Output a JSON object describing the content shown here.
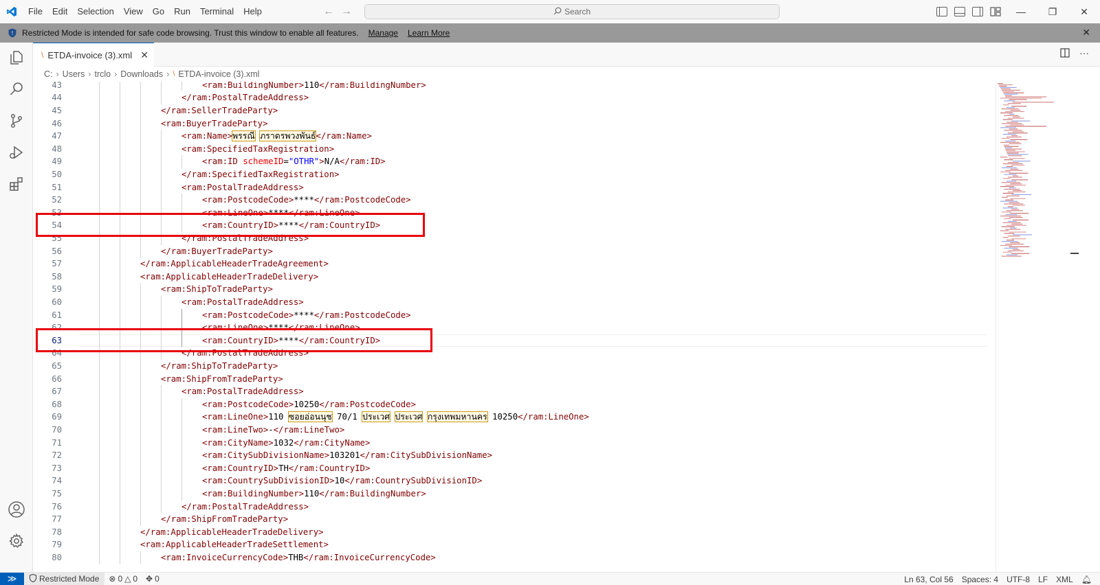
{
  "titlebar": {
    "menu": [
      "File",
      "Edit",
      "Selection",
      "View",
      "Go",
      "Run",
      "Terminal",
      "Help"
    ],
    "search_placeholder": "Search"
  },
  "banner": {
    "message": "Restricted Mode is intended for safe code browsing. Trust this window to enable all features.",
    "manage_label": "Manage",
    "learn_more_label": "Learn More"
  },
  "tab": {
    "label": "ETDA-invoice (3).xml"
  },
  "breadcrumbs": [
    "C:",
    "Users",
    "trclo",
    "Downloads",
    "ETDA-invoice (3).xml"
  ],
  "editor": {
    "active_line": 63,
    "lines": [
      {
        "n": "43",
        "indent": 6,
        "code": "<ram:BuildingNumber>110</ram:BuildingNumber>"
      },
      {
        "n": "44",
        "indent": 5,
        "code": "</ram:PostalTradeAddress>"
      },
      {
        "n": "45",
        "indent": 4,
        "code": "</ram:SellerTradeParty>"
      },
      {
        "n": "46",
        "indent": 4,
        "code": "<ram:BuyerTradeParty>"
      },
      {
        "n": "47",
        "indent": 5,
        "code": "<ram:Name>พรรณี ภราดรพวงพันธ์</ram:Name>"
      },
      {
        "n": "48",
        "indent": 5,
        "code": "<ram:SpecifiedTaxRegistration>"
      },
      {
        "n": "49",
        "indent": 6,
        "code": "<ram:ID schemeID=\"OTHR\">N/A</ram:ID>"
      },
      {
        "n": "50",
        "indent": 5,
        "code": "</ram:SpecifiedTaxRegistration>"
      },
      {
        "n": "51",
        "indent": 5,
        "code": "<ram:PostalTradeAddress>"
      },
      {
        "n": "52",
        "indent": 6,
        "code": "<ram:PostcodeCode>****</ram:PostcodeCode>"
      },
      {
        "n": "53",
        "indent": 6,
        "code": "<ram:LineOne>****</ram:LineOne>"
      },
      {
        "n": "54",
        "indent": 6,
        "code": "<ram:CountryID>****</ram:CountryID>"
      },
      {
        "n": "55",
        "indent": 5,
        "code": "</ram:PostalTradeAddress>"
      },
      {
        "n": "56",
        "indent": 4,
        "code": "</ram:BuyerTradeParty>"
      },
      {
        "n": "57",
        "indent": 3,
        "code": "</ram:ApplicableHeaderTradeAgreement>"
      },
      {
        "n": "58",
        "indent": 3,
        "code": "<ram:ApplicableHeaderTradeDelivery>"
      },
      {
        "n": "59",
        "indent": 4,
        "code": "<ram:ShipToTradeParty>"
      },
      {
        "n": "60",
        "indent": 5,
        "code": "<ram:PostalTradeAddress>"
      },
      {
        "n": "61",
        "indent": 6,
        "code": "<ram:PostcodeCode>****</ram:PostcodeCode>"
      },
      {
        "n": "62",
        "indent": 6,
        "code": "<ram:LineOne>****</ram:LineOne>"
      },
      {
        "n": "63",
        "indent": 6,
        "code": "<ram:CountryID>****</ram:CountryID>"
      },
      {
        "n": "64",
        "indent": 5,
        "code": "</ram:PostalTradeAddress>"
      },
      {
        "n": "65",
        "indent": 4,
        "code": "</ram:ShipToTradeParty>"
      },
      {
        "n": "66",
        "indent": 4,
        "code": "<ram:ShipFromTradeParty>"
      },
      {
        "n": "67",
        "indent": 5,
        "code": "<ram:PostalTradeAddress>"
      },
      {
        "n": "68",
        "indent": 6,
        "code": "<ram:PostcodeCode>10250</ram:PostcodeCode>"
      },
      {
        "n": "69",
        "indent": 6,
        "code": "<ram:LineOne>110 ซอยอ่อนนุช 70/1 ประเวศ ประเวศ กรุงเทพมหานคร 10250</ram:LineOne>"
      },
      {
        "n": "70",
        "indent": 6,
        "code": "<ram:LineTwo>-</ram:LineTwo>"
      },
      {
        "n": "71",
        "indent": 6,
        "code": "<ram:CityName>1032</ram:CityName>"
      },
      {
        "n": "72",
        "indent": 6,
        "code": "<ram:CitySubDivisionName>103201</ram:CitySubDivisionName>"
      },
      {
        "n": "73",
        "indent": 6,
        "code": "<ram:CountryID>TH</ram:CountryID>"
      },
      {
        "n": "74",
        "indent": 6,
        "code": "<ram:CountrySubDivisionID>10</ram:CountrySubDivisionID>"
      },
      {
        "n": "75",
        "indent": 6,
        "code": "<ram:BuildingNumber>110</ram:BuildingNumber>"
      },
      {
        "n": "76",
        "indent": 5,
        "code": "</ram:PostalTradeAddress>"
      },
      {
        "n": "77",
        "indent": 4,
        "code": "</ram:ShipFromTradeParty>"
      },
      {
        "n": "78",
        "indent": 3,
        "code": "</ram:ApplicableHeaderTradeDelivery>"
      },
      {
        "n": "79",
        "indent": 3,
        "code": "<ram:ApplicableHeaderTradeSettlement>"
      },
      {
        "n": "80",
        "indent": 4,
        "code": "<ram:InvoiceCurrencyCode>THB</ram:InvoiceCurrencyCode>"
      }
    ]
  },
  "statusbar": {
    "restricted_label": "Restricted Mode",
    "errors": "0",
    "warnings": "0",
    "ports": "0",
    "position": "Ln 63, Col 56",
    "spaces": "Spaces: 4",
    "encoding": "UTF-8",
    "eol": "LF",
    "language": "XML"
  },
  "icons": {
    "activity": [
      "explorer-icon",
      "search-icon",
      "source-control-icon",
      "run-debug-icon",
      "extensions-icon",
      "accounts-icon",
      "manage-gear-icon"
    ]
  },
  "colors": {
    "accent": "#005fb8",
    "annotation_red": "#e8000b",
    "banner": "#999999",
    "tag": "#800000",
    "attribute": "#e50000",
    "string": "#0000ff"
  }
}
